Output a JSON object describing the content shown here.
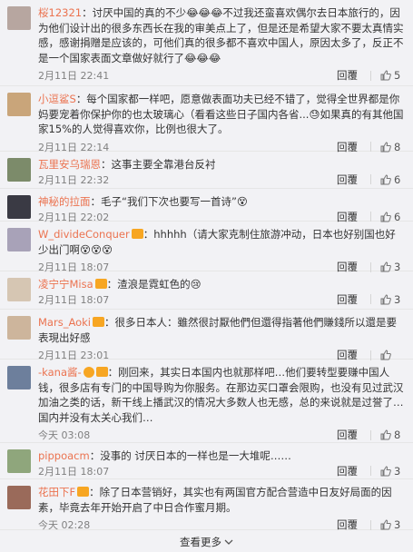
{
  "ui": {
    "reply_label": "回覆",
    "like_icon": "thumbs-up-icon",
    "accent": "#eb7350"
  },
  "comments": [
    {
      "name": "桜12321",
      "body": "：讨厌中国的真的不少😂😂😂不过我还蛮喜欢偶尔去日本旅行的，因为他们设计出的很多东西长在我的审美点上了，但是还是希望大家不要太真情实感，感谢捐赠是应该的，可他们真的很多都不喜欢中国人，原因太多了，反正不是一个国家表面文章做好就行了😂😂😂",
      "time": "2月11日 22:41",
      "likes": "5",
      "avatar": "#b7a6a0"
    },
    {
      "name": "小逗鲨S",
      "body": "：每个国家都一样吧，愿意做表面功夫已经不错了，觉得全世界都是你妈要宠着你保护你的也太玻璃心（看看这些日子国内各省...😓如果真的有其他国家15%的人觉得喜欢你，比例也很大了。",
      "time": "2月11日 22:14",
      "likes": "8",
      "avatar": "#c9a57a"
    },
    {
      "name": "瓦里安乌瑞恩",
      "body": "：这事主要全靠港台反衬",
      "time": "2月11日 22:32",
      "likes": "6",
      "avatar": "#7c8b6a"
    },
    {
      "name": "神秘的拉面",
      "body": "：毛子“我们下次也要写一首诗”😵",
      "time": "2月11日 22:02",
      "likes": "6",
      "avatar": "#3a3a44"
    },
    {
      "name": "W_divideConquer",
      "body": "：hhhhh（请大家克制住旅游冲动，日本也好别国也好少出门啊😵😵😵",
      "time": "2月11日 18:07",
      "likes": "3",
      "avatar": "#a8a2b8"
    },
    {
      "name": "凌宁宁Misa",
      "body": "：渣浪是霓虹色的😢",
      "time": "2月11日 18:07",
      "likes": "3",
      "avatar": "#d6c6b3"
    },
    {
      "name": "Mars_Aoki",
      "body": "：很多日本人：雖然很討厭他們但還得指著他們賺錢所以還是要表現出好感",
      "time": "2月11日 23:01",
      "likes": "",
      "avatar": "#cdb59c"
    },
    {
      "name": "-kana酱-",
      "body": "：刚回来，其实日本国内也就那样吧…他们要转型要赚中国人钱，很多店有专门的中国导购为你服务。在那边买口罩会限购，也没有见过武汉加油之类的话，新干线上播武汉的情况大多数人也无感，总的来说就是过誉了…国内并没有太关心我们…",
      "time": "今天 03:08",
      "likes": "8",
      "avatar": "#6d7f9c"
    },
    {
      "name": "pippoacm",
      "body": "：没事的 讨厌日本的一样也是一大堆呢……",
      "time": "2月11日 18:07",
      "likes": "3",
      "avatar": "#8fa67c"
    },
    {
      "name": "花田下F",
      "body": "：除了日本营销好，其实也有两国官方配合营造中日友好局面的因素，毕竟去年开始开启了中日合作蜜月期。",
      "time": "今天 02:28",
      "likes": "3",
      "avatar": "#9a6a5a"
    }
  ],
  "footer": {
    "more_label": "查看更多"
  }
}
